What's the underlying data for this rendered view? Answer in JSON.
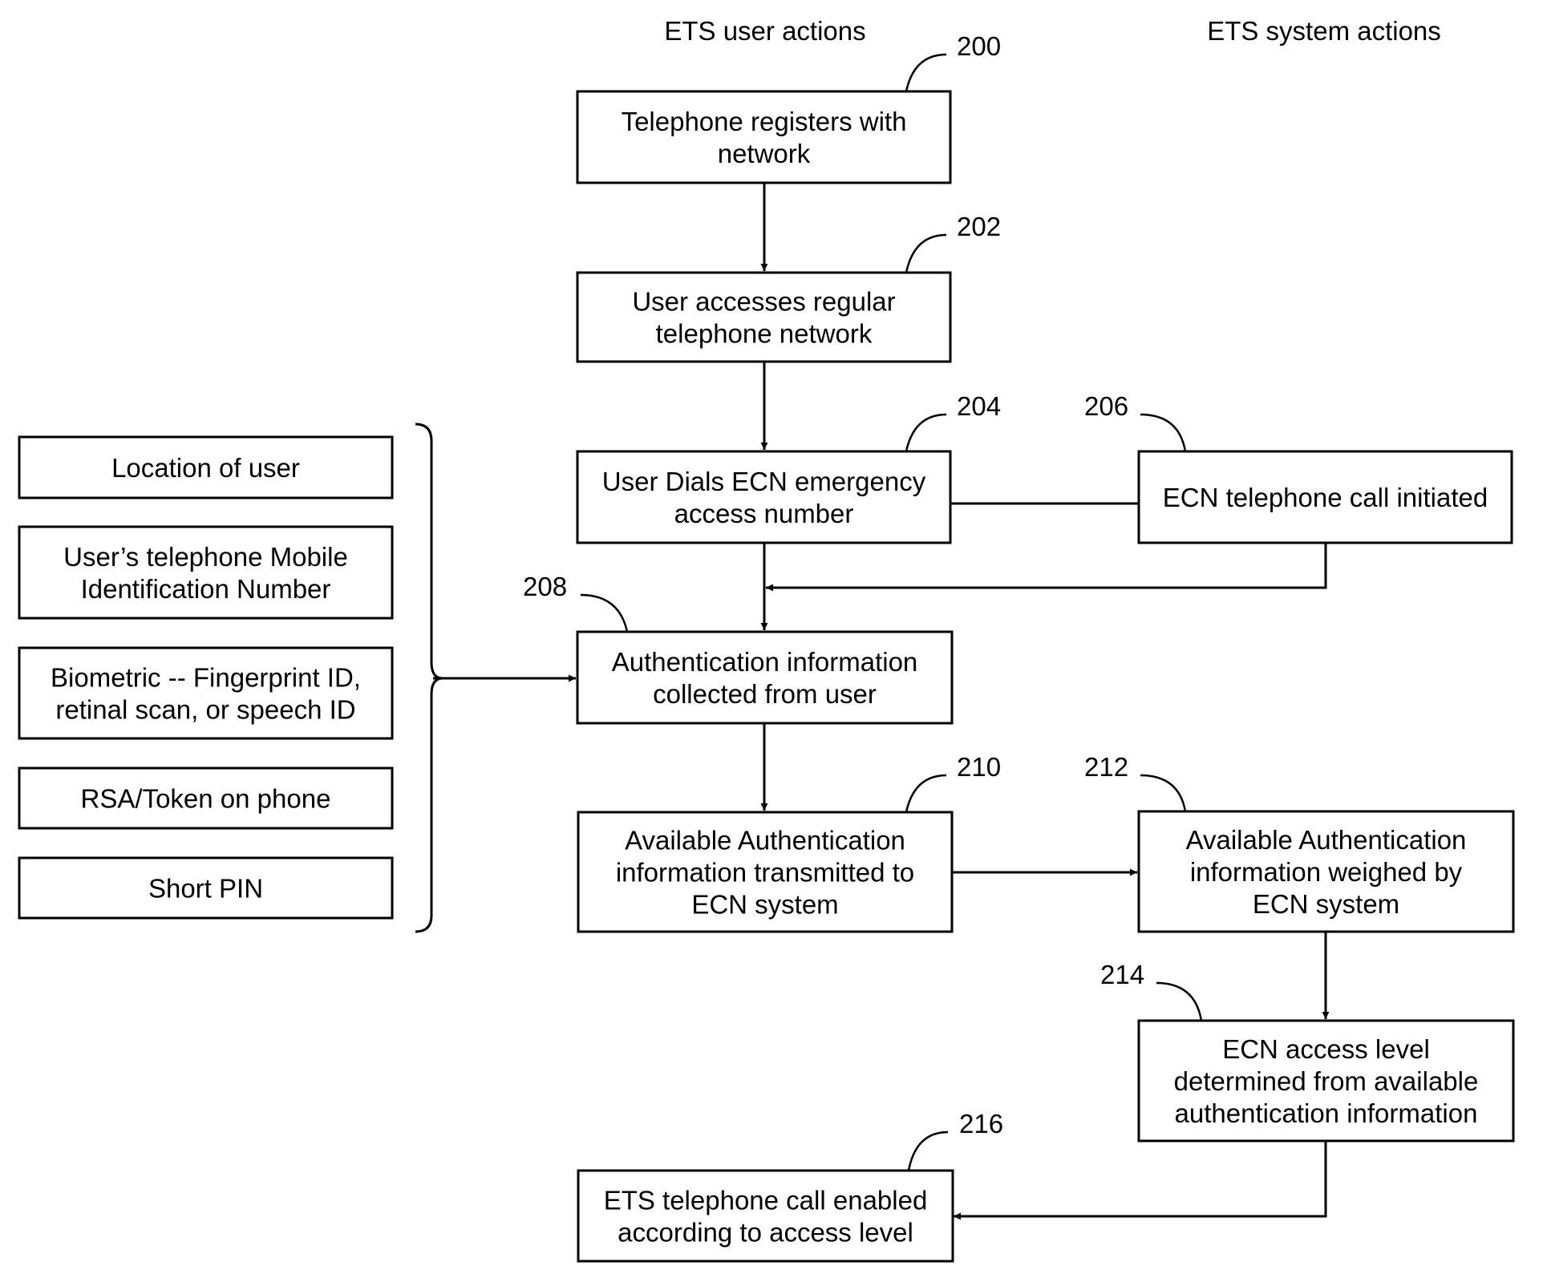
{
  "headers": {
    "user_actions": "ETS user actions",
    "system_actions": "ETS system actions"
  },
  "steps": {
    "s200": {
      "ref": "200",
      "lines": [
        "Telephone registers with",
        "network"
      ]
    },
    "s202": {
      "ref": "202",
      "lines": [
        "User accesses regular",
        "telephone network"
      ]
    },
    "s204": {
      "ref": "204",
      "lines": [
        "User Dials ECN emergency",
        "access number"
      ]
    },
    "s206": {
      "ref": "206",
      "lines": [
        "ECN telephone call initiated"
      ]
    },
    "s208": {
      "ref": "208",
      "lines": [
        "Authentication information",
        "collected from user"
      ]
    },
    "s210": {
      "ref": "210",
      "lines": [
        "Available Authentication",
        "information transmitted to",
        "ECN system"
      ]
    },
    "s212": {
      "ref": "212",
      "lines": [
        "Available Authentication",
        "information weighed by",
        "ECN system"
      ]
    },
    "s214": {
      "ref": "214",
      "lines": [
        "ECN access level",
        "determined from available",
        "authentication information"
      ]
    },
    "s216": {
      "ref": "216",
      "lines": [
        "ETS telephone call enabled",
        "according to access level"
      ]
    }
  },
  "auth_sources": [
    {
      "lines": [
        "Location of user"
      ]
    },
    {
      "lines": [
        "User’s telephone Mobile",
        "Identification Number"
      ]
    },
    {
      "lines": [
        "Biometric -- Fingerprint ID,",
        "retinal scan, or speech ID"
      ]
    },
    {
      "lines": [
        "RSA/Token on phone"
      ]
    },
    {
      "lines": [
        "Short PIN"
      ]
    }
  ]
}
